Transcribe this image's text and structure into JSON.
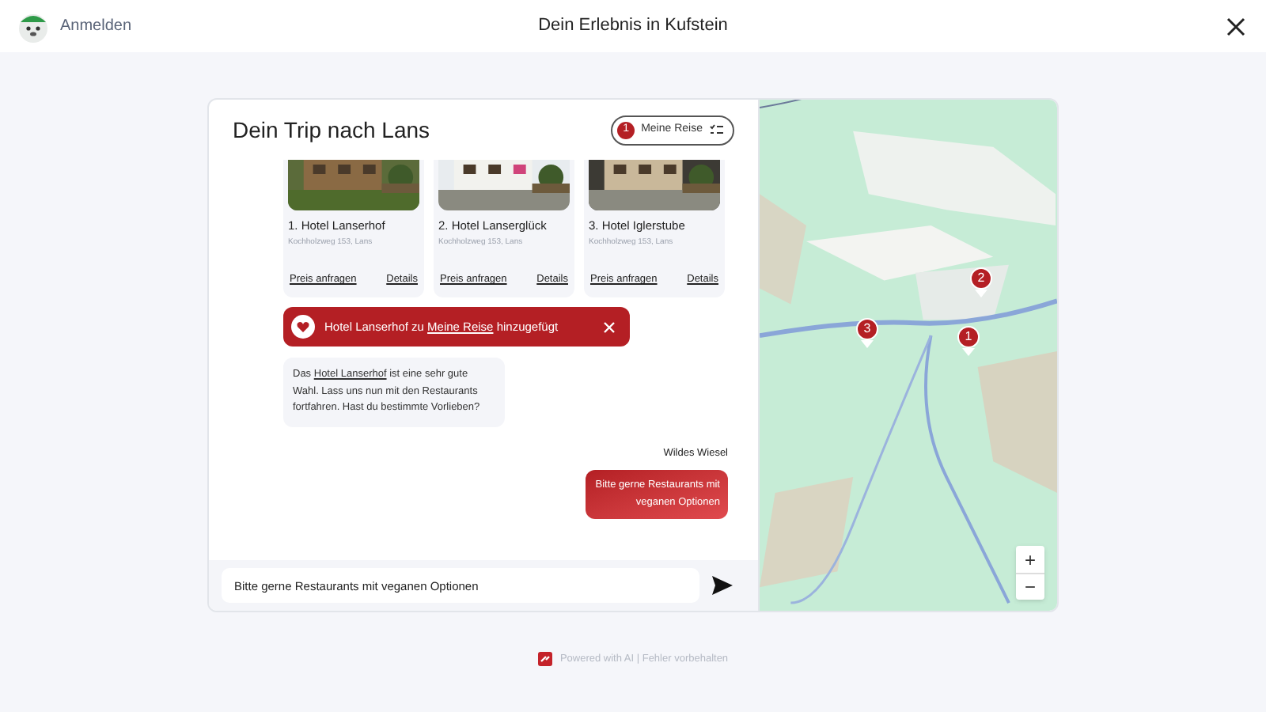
{
  "header": {
    "login": "Anmelden",
    "title": "Dein Erlebnis in Kufstein"
  },
  "chat": {
    "title": "Dein Trip nach Lans",
    "trip_button": {
      "count": "1",
      "label": "Meine Reise"
    },
    "hotels": [
      {
        "name": "1. Hotel Lanserhof",
        "address": "Kochholzweg 153, Lans",
        "price_link": "Preis anfragen",
        "details_link": "Details"
      },
      {
        "name": "2. Hotel Lanserglück",
        "address": "Kochholzweg 153, Lans",
        "price_link": "Preis anfragen",
        "details_link": "Details"
      },
      {
        "name": "3. Hotel Iglerstube",
        "address": "Kochholzweg 153, Lans",
        "price_link": "Preis anfragen",
        "details_link": "Details"
      }
    ],
    "toast": {
      "before": "Hotel Lanserhof zu ",
      "link": "Meine Reise",
      "after": " hinzugefügt"
    },
    "bot_message": {
      "before": "Das ",
      "link": "Hotel Lanserhof",
      "after": " ist eine sehr gute Wahl. Lass uns nun mit den Restaurants fortfahren. Hast du bestimmte Vorlieben?"
    },
    "user_name": "Wildes Wiesel",
    "user_message": "Bitte gerne Restaurants mit veganen Optionen",
    "input_value": "Bitte gerne Restaurants mit veganen Optionen"
  },
  "map": {
    "markers": [
      {
        "label": "2"
      },
      {
        "label": "1"
      },
      {
        "label": "3"
      }
    ],
    "zoom_in": "+",
    "zoom_out": "−"
  },
  "footer": "Powered with AI | Fehler vorbehalten"
}
